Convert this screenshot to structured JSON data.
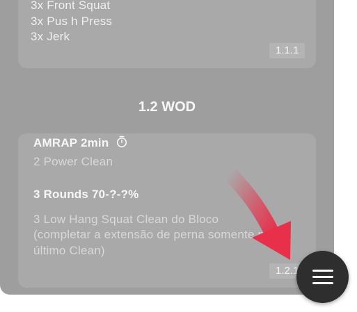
{
  "block_1_1": {
    "lines": [
      "3x Front Squat",
      "3x Pus h Press",
      "3x Jerk"
    ],
    "code": "1.1.1"
  },
  "section": {
    "title": "1.2 WOD"
  },
  "block_1_2": {
    "amrap_title": "AMRAP  2min",
    "amrap_item": "2 Power Clean",
    "rounds_title": "3 Rounds 70-?-?%",
    "rounds_lines": [
      "3 Low Hang Squat Clean do Bloco",
      "(completar a extensão de perna somente no",
      "último Clean)"
    ],
    "code": "1.2.1"
  },
  "icons": {
    "timer": "stopwatch-icon",
    "menu": "hamburger-menu-icon",
    "hint": "curved-arrow-icon"
  },
  "colors": {
    "fab": "#2e2e2e",
    "arrow": "#e8304a"
  }
}
